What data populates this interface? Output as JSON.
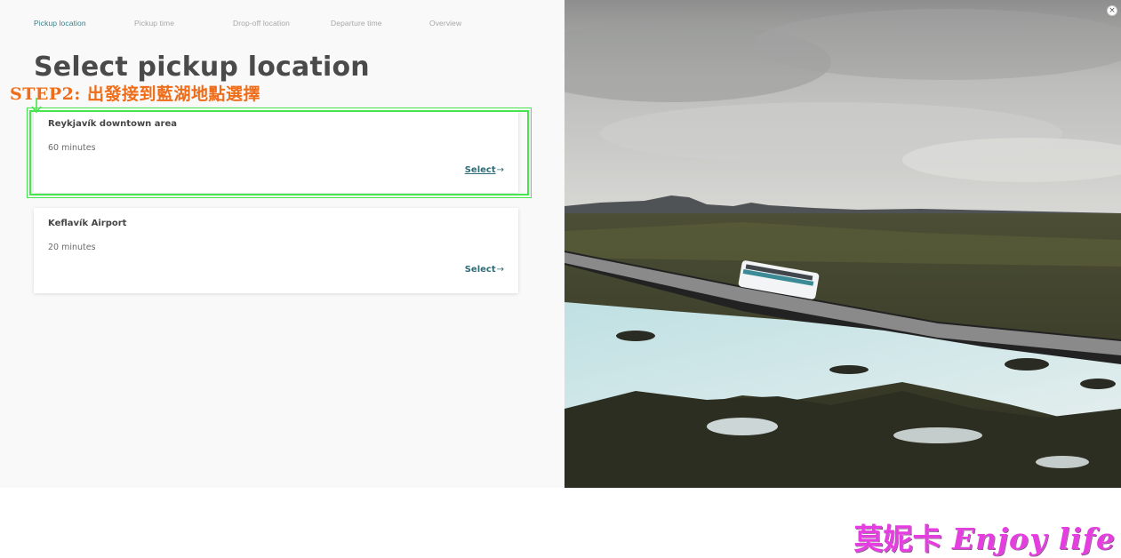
{
  "steps": [
    {
      "label": "Pickup location",
      "active": true
    },
    {
      "label": "Pickup time",
      "active": false
    },
    {
      "label": "Drop-off location",
      "active": false
    },
    {
      "label": "Departure time",
      "active": false
    },
    {
      "label": "Overview",
      "active": false
    }
  ],
  "page": {
    "title": "Select pickup location"
  },
  "annotation": {
    "text": "STEP2: 出發接到藍湖地點選擇",
    "color": "#ef6c19"
  },
  "locations": [
    {
      "name": "Reykjavík downtown area",
      "duration": "60 minutes",
      "select_label": "Select",
      "select_arrow": "→",
      "highlighted": true
    },
    {
      "name": "Keflavík Airport",
      "duration": "20 minutes",
      "select_label": "Select",
      "select_arrow": "→",
      "highlighted": false
    }
  ],
  "close": {
    "glyph": "×"
  },
  "watermark": {
    "cjk": "莫妮卡",
    "latin": "Enjoy life"
  },
  "colors": {
    "accent": "#2f6e78",
    "step_active": "#3a7f8a",
    "highlight": "#47e54d",
    "watermark": "#e53de0"
  }
}
